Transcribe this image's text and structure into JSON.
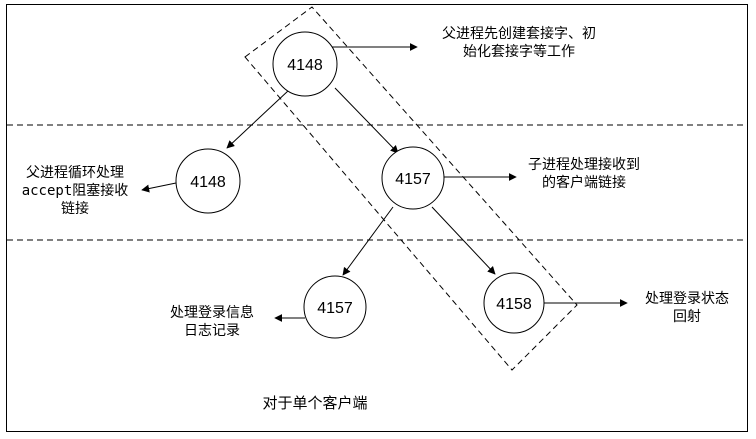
{
  "nodes": {
    "root_parent": "4148",
    "parent_loop": "4148",
    "child": "4157",
    "child_log": "4157",
    "grandchild": "4158"
  },
  "labels": {
    "parent_init_line1": "父进程先创建套接字、初",
    "parent_init_line2": "始化套接字等工作",
    "parent_loop_line1": "父进程循环处理",
    "parent_loop_line2": "accept阻塞接收",
    "parent_loop_line3": "链接",
    "child_handle_line1": "子进程处理接收到",
    "child_handle_line2": "的客户端链接",
    "login_log_line1": "处理登录信息",
    "login_log_line2": "日志记录",
    "login_status_line1": "处理登录状态",
    "login_status_line2": "回射",
    "caption": "对于单个客户端"
  }
}
